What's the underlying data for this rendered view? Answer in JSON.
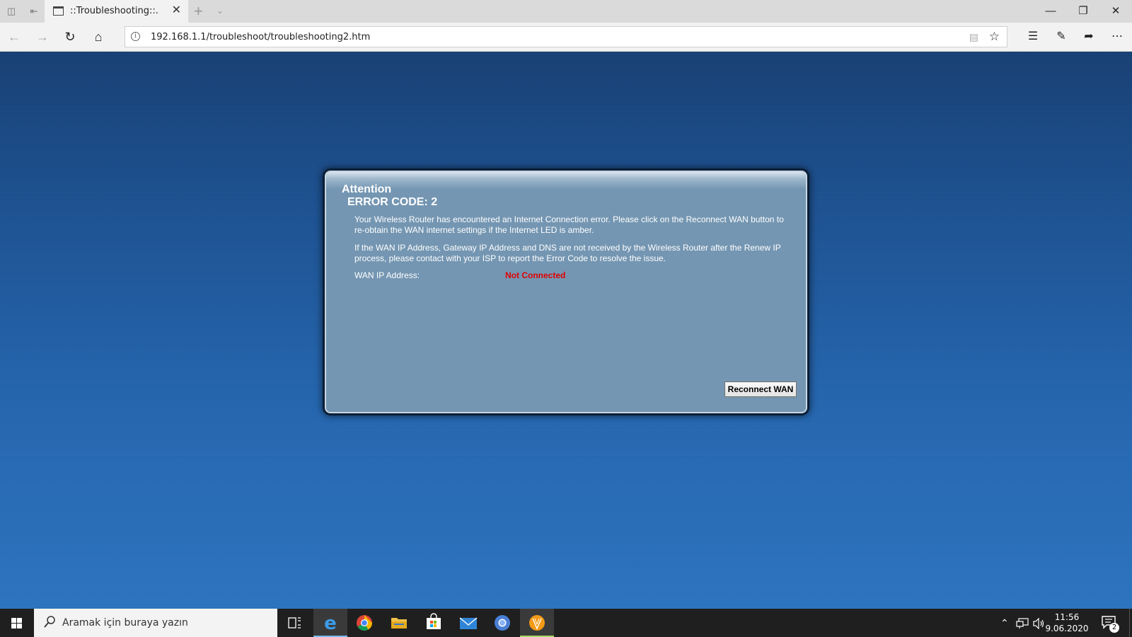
{
  "browser": {
    "tab_title": "::Troubleshooting::.",
    "url": "192.168.1.1/troubleshoot/troubleshooting2.htm"
  },
  "dialog": {
    "heading": "Attention",
    "error_code": "ERROR CODE: 2",
    "paragraph1": "Your Wireless Router has encountered an Internet Connection error. Please click on the Reconnect WAN button to re-obtain the WAN internet settings if the Internet LED is amber.",
    "paragraph2": "If the WAN IP Address, Gateway IP Address and DNS are not received by the Wireless Router after the Renew IP process, please contact with your ISP to report the Error Code to resolve the issue.",
    "wan_label": "WAN IP Address:",
    "wan_value": "Not Connected",
    "reconnect_label": "Reconnect WAN"
  },
  "taskbar": {
    "search_placeholder": "Aramak için buraya yazın",
    "time": "11:56",
    "date": "9.06.2020",
    "notification_count": "2"
  },
  "colors": {
    "page_bg": "#1c5293",
    "dialog_bg": "#7496b2",
    "error_text": "#e00000",
    "taskbar_bg": "#1f1f1f"
  }
}
